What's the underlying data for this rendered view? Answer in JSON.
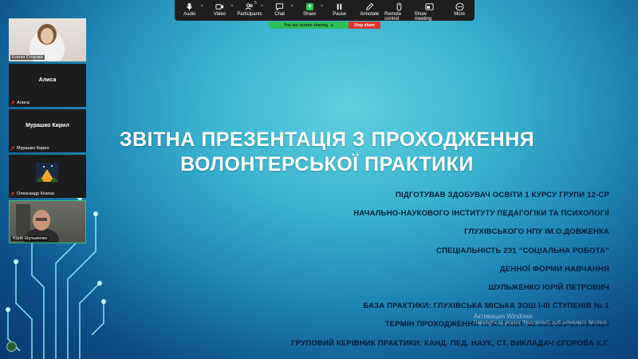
{
  "toolbar": {
    "items": [
      {
        "label": "Audio",
        "icon": "microphone-icon"
      },
      {
        "label": "Video",
        "icon": "video-camera-icon"
      },
      {
        "label": "Participants",
        "icon": "participants-icon",
        "count": "5"
      },
      {
        "label": "Chat",
        "icon": "chat-icon"
      },
      {
        "label": "Share",
        "icon": "share-screen-icon"
      },
      {
        "label": "Pause",
        "icon": "pause-icon"
      },
      {
        "label": "Annotate",
        "icon": "pencil-icon"
      },
      {
        "label": "Remote control",
        "icon": "mouse-icon"
      },
      {
        "label": "Show meeting",
        "icon": "window-icon"
      },
      {
        "label": "More",
        "icon": "more-icon"
      }
    ]
  },
  "sharing": {
    "status": "You are screen sharing",
    "stop_label": "Stop share"
  },
  "participants": [
    {
      "name": "Ксенія Єгорова",
      "type": "video"
    },
    {
      "name": "Алиса",
      "big_name": "Алиса",
      "type": "name"
    },
    {
      "name": "Мурашко Кирил",
      "big_name": "Мурашко Кирил",
      "type": "name"
    },
    {
      "name": "Олександр Козеха",
      "type": "avatar"
    },
    {
      "name": "Юрій Шульженко",
      "type": "video"
    }
  ],
  "slide": {
    "title_line1": "ЗВІТНА ПРЕЗЕНТАЦІЯ З ПРОХОДЖЕННЯ",
    "title_line2": "ВОЛОНТЕРСЬКОЇ ПРАКТИКИ",
    "lines": [
      "ПІДГОТУВАВ ЗДОБУВАЧ ОСВІТИ 1 КУРСУ ГРУПИ 12-СР",
      "НАЧАЛЬНО-НАУКОВОГО ІНСТИТУТУ ПЕДАГОГІКИ ТА ПСИХОЛОГІЇ",
      "ГЛУХІВСЬКОГО НПУ ІМ.О.ДОВЖЕНКА",
      "СПЕЦІАЛЬНІСТЬ 231 “СОЦІАЛЬНА РОБОТА”",
      "ДЕННОЇ ФОРМИ НАВЧАННЯ",
      "ШУЛЬЖЕНКО ЮРІЙ ПЕТРОВИЧ",
      "БАЗА ПРАКТИКИ: ГЛУХІВСЬКА МІСЬКА ЗОШ І-ІІІ СТУПЕНІВ № 1",
      "ТЕРМІН ПРОХОДЖЕННЯ ПРАКТИКИ: 03.03.2025-16.05.2024",
      "ГРУПОВИЙ КЕРІВНИК ПРАКТИКИ: КАНД. ПЕД. НАУК, СТ. ВИКЛАДАЧ ЄГОРОВА К.Г."
    ]
  },
  "watermark": {
    "line1": "Активация Windows",
    "line2": "Перейдіть до розділу \"Настройки\", щоб активувати Windows."
  },
  "colors": {
    "toolbar_bg": "#1e1e1e",
    "share_green": "#2ebe5a",
    "stop_red": "#e0322f",
    "title": "#ffffff",
    "info_text": "#081a36"
  }
}
